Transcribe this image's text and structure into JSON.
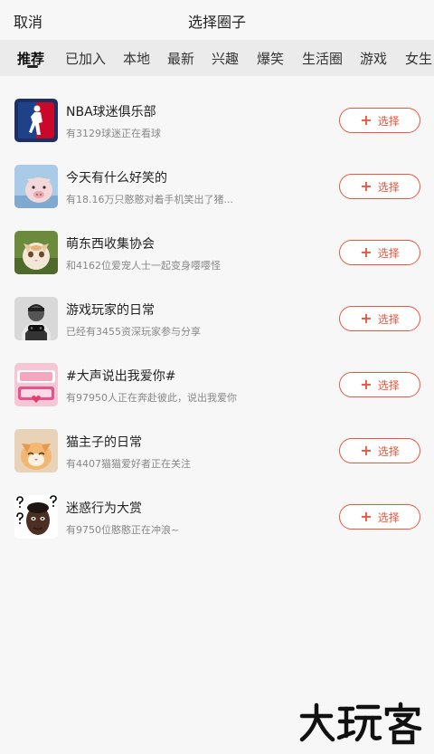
{
  "header": {
    "cancel_label": "取消",
    "title": "选择圈子"
  },
  "tabs": [
    {
      "label": "推荐",
      "active": true
    },
    {
      "label": "已加入"
    },
    {
      "label": "本地"
    },
    {
      "label": "最新"
    },
    {
      "label": "兴趣"
    },
    {
      "label": "爆笑"
    },
    {
      "label": "生活圈"
    },
    {
      "label": "游戏"
    },
    {
      "label": "女生"
    }
  ],
  "colors": {
    "accent": "#e9573f",
    "tab_bar": "#ebebeb",
    "background": "#f7f7f7"
  },
  "circles": [
    {
      "name": "NBA球迷俱乐部",
      "desc": "有3129球迷正在看球",
      "button": "选择",
      "icon": "nba-logo-icon"
    },
    {
      "name": "今天有什么好笑的",
      "desc": "有18.16万只憨憨对着手机笑出了猪...",
      "button": "选择",
      "icon": "pig-photo-icon"
    },
    {
      "name": "萌东西收集协会",
      "desc": "和4162位爱宠人士一起变身嘤嘤怪",
      "button": "选择",
      "icon": "cat-photo-icon"
    },
    {
      "name": "游戏玩家的日常",
      "desc": "已经有3455资深玩家参与分享",
      "button": "选择",
      "icon": "gamer-icon"
    },
    {
      "name": "#大声说出我爱你#",
      "desc": "有97950人正在奔赴彼此，说出我爱你",
      "button": "选择",
      "icon": "love-sticker-icon"
    },
    {
      "name": "猫主子的日常",
      "desc": "有4407猫猫爱好者正在关注",
      "button": "选择",
      "icon": "cat-owner-photo-icon"
    },
    {
      "name": "迷惑行为大赏",
      "desc": "有9750位憨憨正在冲浪~",
      "button": "选择",
      "icon": "confused-face-icon"
    }
  ],
  "watermark": "大玩客"
}
